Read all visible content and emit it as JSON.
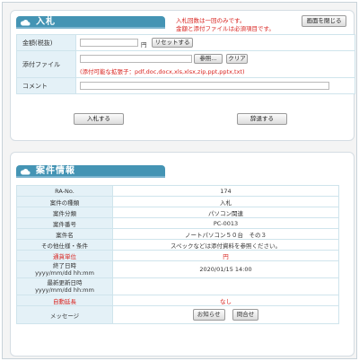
{
  "bid_panel": {
    "title": "入札",
    "notice_line1": "入札回数は一回のみです。",
    "notice_line2": "金額と添付ファイルは必須項目です。",
    "close_button": "画面を閉じる",
    "amount_label": "金額(税抜)",
    "amount_value": "",
    "amount_unit": "円",
    "reset_button": "リセットする",
    "attachment_label": "添付ファイル",
    "attachment_value": "",
    "browse_button": "参照...",
    "clear_button": "クリア",
    "attachment_hint": "(添付可能な拡張子：pdf,doc,docx,xls,xlsx,zip,ppt,pptx,txt)",
    "comment_label": "コメント",
    "comment_value": "",
    "submit_button": "入札する",
    "decline_button": "辞退する"
  },
  "info_panel": {
    "title": "案件情報",
    "rows": [
      {
        "key": "RA-No.",
        "value": "174",
        "red": false
      },
      {
        "key": "案件の種類",
        "value": "入札",
        "red": false
      },
      {
        "key": "案件分類",
        "value": "パソコン関連",
        "red": false
      },
      {
        "key": "案件番号",
        "value": "PC-0013",
        "red": false
      },
      {
        "key": "案件名",
        "value": "ノートパソコン５０台　その３",
        "red": false
      },
      {
        "key": "その他仕様・条件",
        "value": "スペックなどは添付資料を参照ください。",
        "red": false
      },
      {
        "key": "通貨単位",
        "value": "円",
        "red": true
      }
    ],
    "end_date_label_line1": "終了日時",
    "end_date_label_line2": "yyyy/mm/dd hh:mm",
    "end_date_value": "2020/01/15 14:00",
    "updated_label_line1": "最新更新日時",
    "updated_label_line2": "yyyy/mm/dd hh:mm",
    "updated_value": "",
    "auto_extend_label": "自動延長",
    "auto_extend_value": "なし",
    "message_label": "メッセージ",
    "notice_button": "お知らせ",
    "inquiry_button": "問合せ"
  },
  "colors": {
    "header": "#4494b4",
    "label_bg": "#e4f1f7",
    "alert": "#d8231f"
  }
}
